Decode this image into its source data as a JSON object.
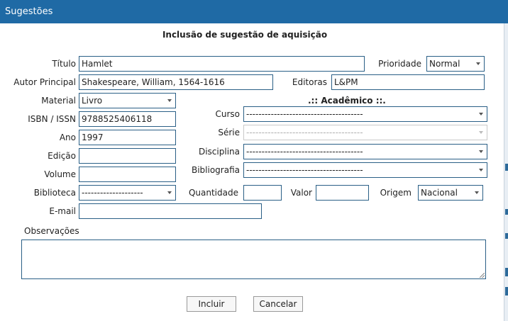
{
  "window": {
    "title": "Sugestões"
  },
  "form": {
    "heading": "Inclusão de sugestão de aquisição",
    "titulo": {
      "label": "Título",
      "value": "Hamlet"
    },
    "prioridade": {
      "label": "Prioridade",
      "value": "Normal"
    },
    "autor": {
      "label": "Autor Principal",
      "value": "Shakespeare, William, 1564-1616"
    },
    "editoras": {
      "label": "Editoras",
      "value": "L&PM"
    },
    "material": {
      "label": "Material",
      "value": "Livro"
    },
    "isbn": {
      "label": "ISBN / ISSN",
      "value": "9788525406118"
    },
    "ano": {
      "label": "Ano",
      "value": "1997"
    },
    "edicao": {
      "label": "Edição",
      "value": ""
    },
    "volume": {
      "label": "Volume",
      "value": ""
    },
    "biblioteca": {
      "label": "Biblioteca",
      "value": "--------------------"
    },
    "quantidade": {
      "label": "Quantidade",
      "value": ""
    },
    "valor": {
      "label": "Valor",
      "value": ""
    },
    "origem": {
      "label": "Origem",
      "value": "Nacional"
    },
    "email": {
      "label": "E-mail",
      "value": ""
    },
    "observacoes": {
      "label": "Observações",
      "value": ""
    }
  },
  "academico": {
    "heading": ".:: Acadêmico ::.",
    "curso": {
      "label": "Curso",
      "value": "--------------------------------------"
    },
    "serie": {
      "label": "Série",
      "value": "--------------------------------------"
    },
    "disciplina": {
      "label": "Disciplina",
      "value": "--------------------------------------"
    },
    "bibliografia": {
      "label": "Bibliografia",
      "value": "--------------------------------------"
    }
  },
  "buttons": {
    "incluir": "Incluir",
    "cancelar": "Cancelar"
  },
  "colors": {
    "titlebar": "#1f6aa5",
    "field_border": "#2a5f86"
  }
}
